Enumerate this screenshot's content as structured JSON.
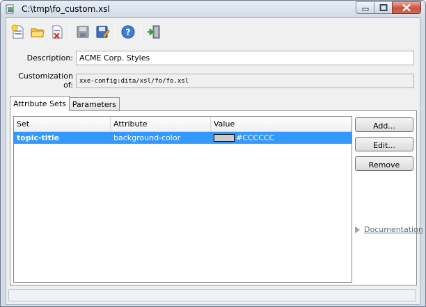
{
  "window": {
    "title": "C:\\tmp\\fo_custom.xsl"
  },
  "toolbar": {
    "buttons": [
      {
        "icon": "new-document-icon"
      },
      {
        "icon": "open-folder-icon"
      },
      {
        "icon": "close-document-icon"
      },
      {
        "icon": "save-icon"
      },
      {
        "icon": "save-as-icon"
      },
      {
        "icon": "help-icon"
      },
      {
        "icon": "exit-icon"
      }
    ]
  },
  "form": {
    "description_label": "Description:",
    "description_value": "ACME Corp. Styles",
    "customization_label": "Customization of:",
    "customization_value": "xxe-config:dita/xsl/fo/fo.xsl"
  },
  "tabs": [
    {
      "label": "Attribute Sets",
      "active": true
    },
    {
      "label": "Parameters",
      "active": false
    }
  ],
  "table": {
    "columns": [
      "Set",
      "Attribute",
      "Value"
    ],
    "rows": [
      {
        "set": "topic-title",
        "attribute": "background-color",
        "value": "#CCCCCC",
        "swatch": "#cccccc",
        "selected": true
      }
    ]
  },
  "side_buttons": {
    "add": "Add...",
    "edit": "Edit...",
    "remove": "Remove"
  },
  "documentation_link": "Documentation",
  "colors": {
    "selection": "#3399ff",
    "window_frame": "#d4dbe4"
  }
}
